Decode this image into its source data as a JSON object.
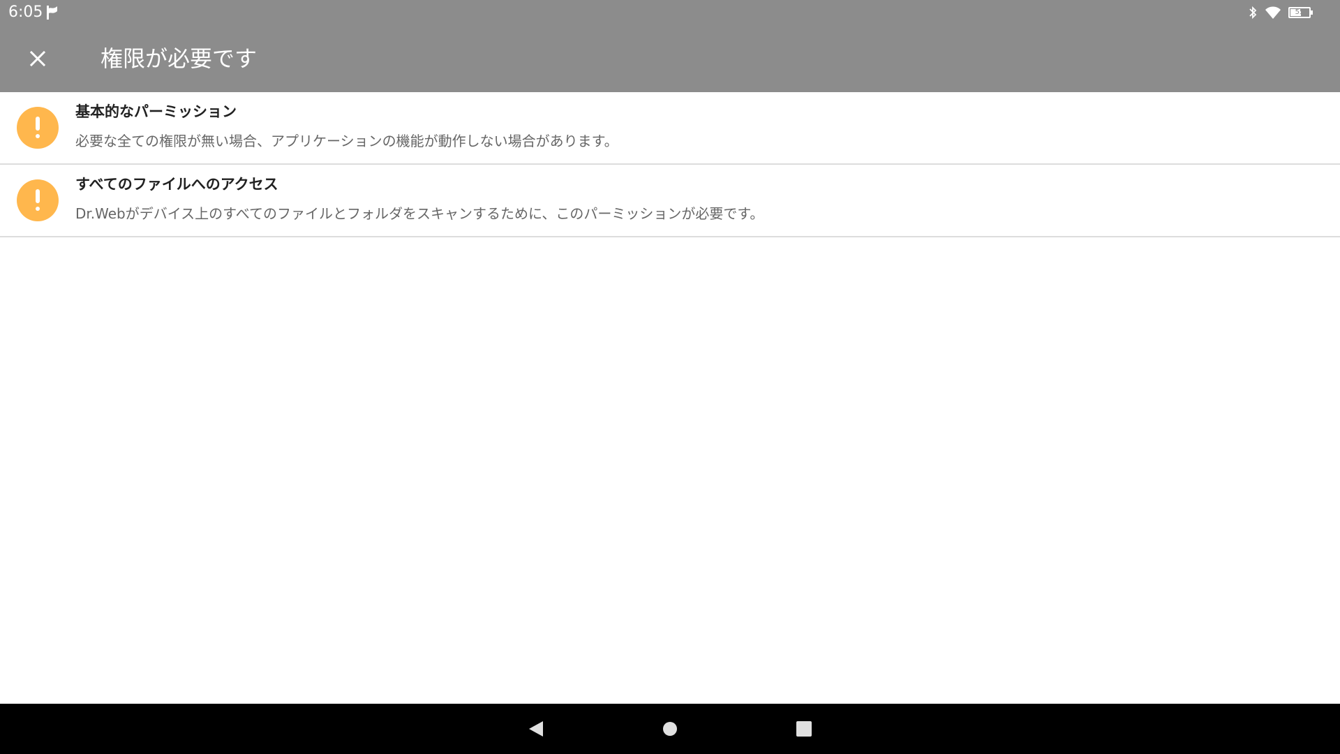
{
  "status_bar": {
    "time": "6:05",
    "notification_icon": "flag-icon",
    "battery_level": "55",
    "icons": [
      "bluetooth-icon",
      "wifi-icon",
      "battery-icon"
    ]
  },
  "app_bar": {
    "title": "権限が必要です",
    "close_icon": "close-icon",
    "background_color": "#8c8c8c"
  },
  "permissions": [
    {
      "title": "基本的なパーミッション",
      "description": "必要な全ての権限が無い場合、アプリケーションの機能が動作しない場合があります。",
      "icon": "warning-icon",
      "icon_color": "#ffb74d"
    },
    {
      "title": "すべてのファイルへのアクセス",
      "description": "Dr.Webがデバイス上のすべてのファイルとフォルダをスキャンするために、このパーミッションが必要です。",
      "icon": "warning-icon",
      "icon_color": "#ffb74d"
    }
  ],
  "nav_bar": {
    "buttons": [
      "back-icon",
      "home-icon",
      "recents-icon"
    ]
  }
}
